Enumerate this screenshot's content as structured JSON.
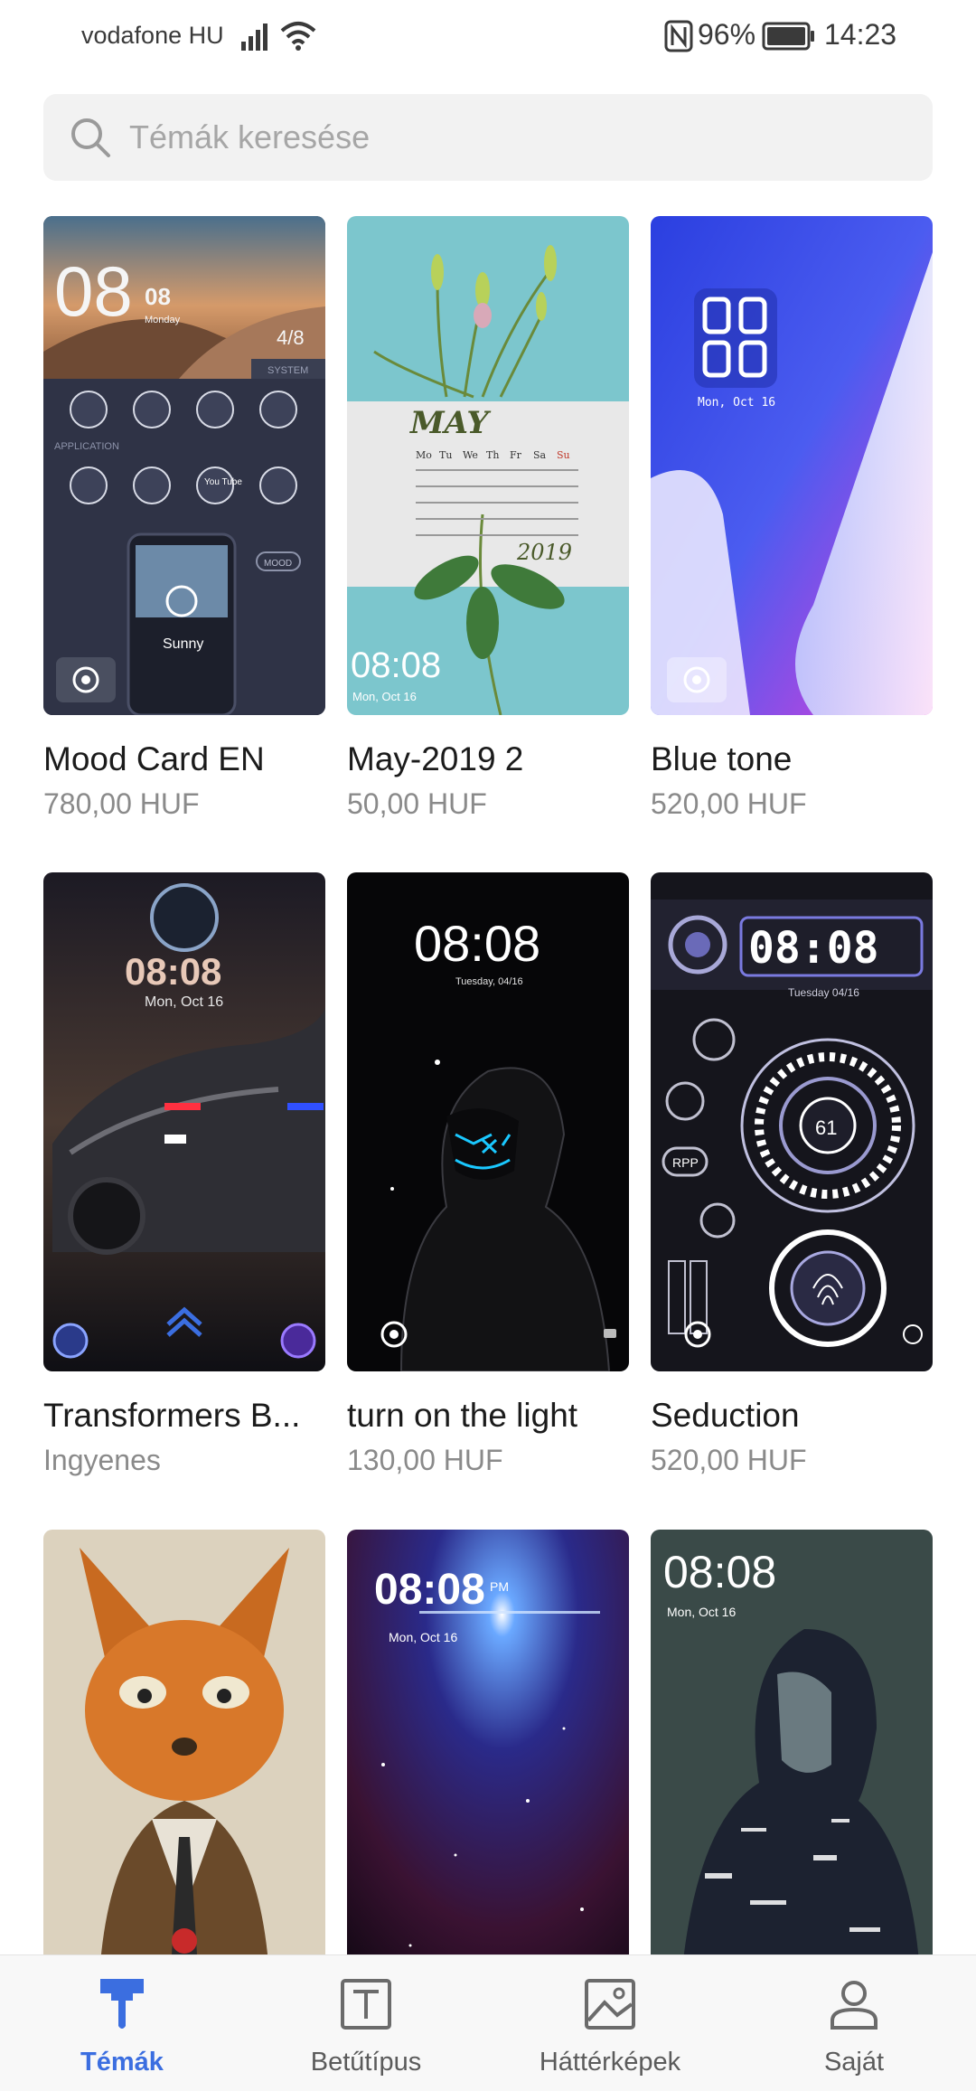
{
  "status_bar": {
    "carrier": "vodafone HU",
    "battery": "96%",
    "time": "14:23"
  },
  "search": {
    "placeholder": "Témák keresése"
  },
  "themes": [
    {
      "title": "Mood Card EN",
      "price": "780,00 HUF"
    },
    {
      "title": "May-2019 2",
      "price": "50,00 HUF"
    },
    {
      "title": "Blue tone",
      "price": "520,00 HUF"
    },
    {
      "title": "Transformers B...",
      "price": "Ingyenes"
    },
    {
      "title": "turn on the light",
      "price": "130,00 HUF"
    },
    {
      "title": "Seduction",
      "price": "520,00 HUF"
    },
    {
      "title": "",
      "price": ""
    },
    {
      "title": "",
      "price": ""
    },
    {
      "title": "",
      "price": ""
    }
  ],
  "previews": {
    "mood": {
      "time": "08",
      "time_small": "08",
      "day": "Monday",
      "date": "4/8",
      "system": "SYSTEM",
      "application": "APPLICATION",
      "youtube": "You Tube",
      "mood": "MOOD",
      "weather": "Sunny"
    },
    "may": {
      "month": "MAY",
      "weekdays": [
        "Mo",
        "Tu",
        "We",
        "Th",
        "Fr",
        "Sa",
        "Su"
      ],
      "year": "2019",
      "time": "08:08",
      "date": "Mon, Oct 16"
    },
    "blue": {
      "date": "Mon, Oct 16"
    },
    "transformers": {
      "time": "08:08",
      "date": "Mon, Oct 16"
    },
    "light": {
      "time": "08:08",
      "date": "Tuesday, 04/16"
    },
    "seduction": {
      "time": "08:08",
      "date": "Tuesday 04/16",
      "gauge": "61",
      "rpp": "RPP"
    },
    "cosmic": {
      "time": "08:08",
      "ampm": "PM",
      "date": "Mon, Oct 16"
    },
    "hoodie": {
      "time": "08:08",
      "date": "Mon, Oct 16"
    }
  },
  "bottom_nav": [
    {
      "label": "Témák",
      "icon": "paint-roller-icon",
      "active": true
    },
    {
      "label": "Betűtípus",
      "icon": "font-icon",
      "active": false
    },
    {
      "label": "Háttérképek",
      "icon": "wallpaper-icon",
      "active": false
    },
    {
      "label": "Saját",
      "icon": "person-icon",
      "active": false
    }
  ],
  "colors": {
    "accent": "#3b6ee0",
    "search_bg": "#f2f2f2",
    "price_text": "#8a8a8a"
  }
}
